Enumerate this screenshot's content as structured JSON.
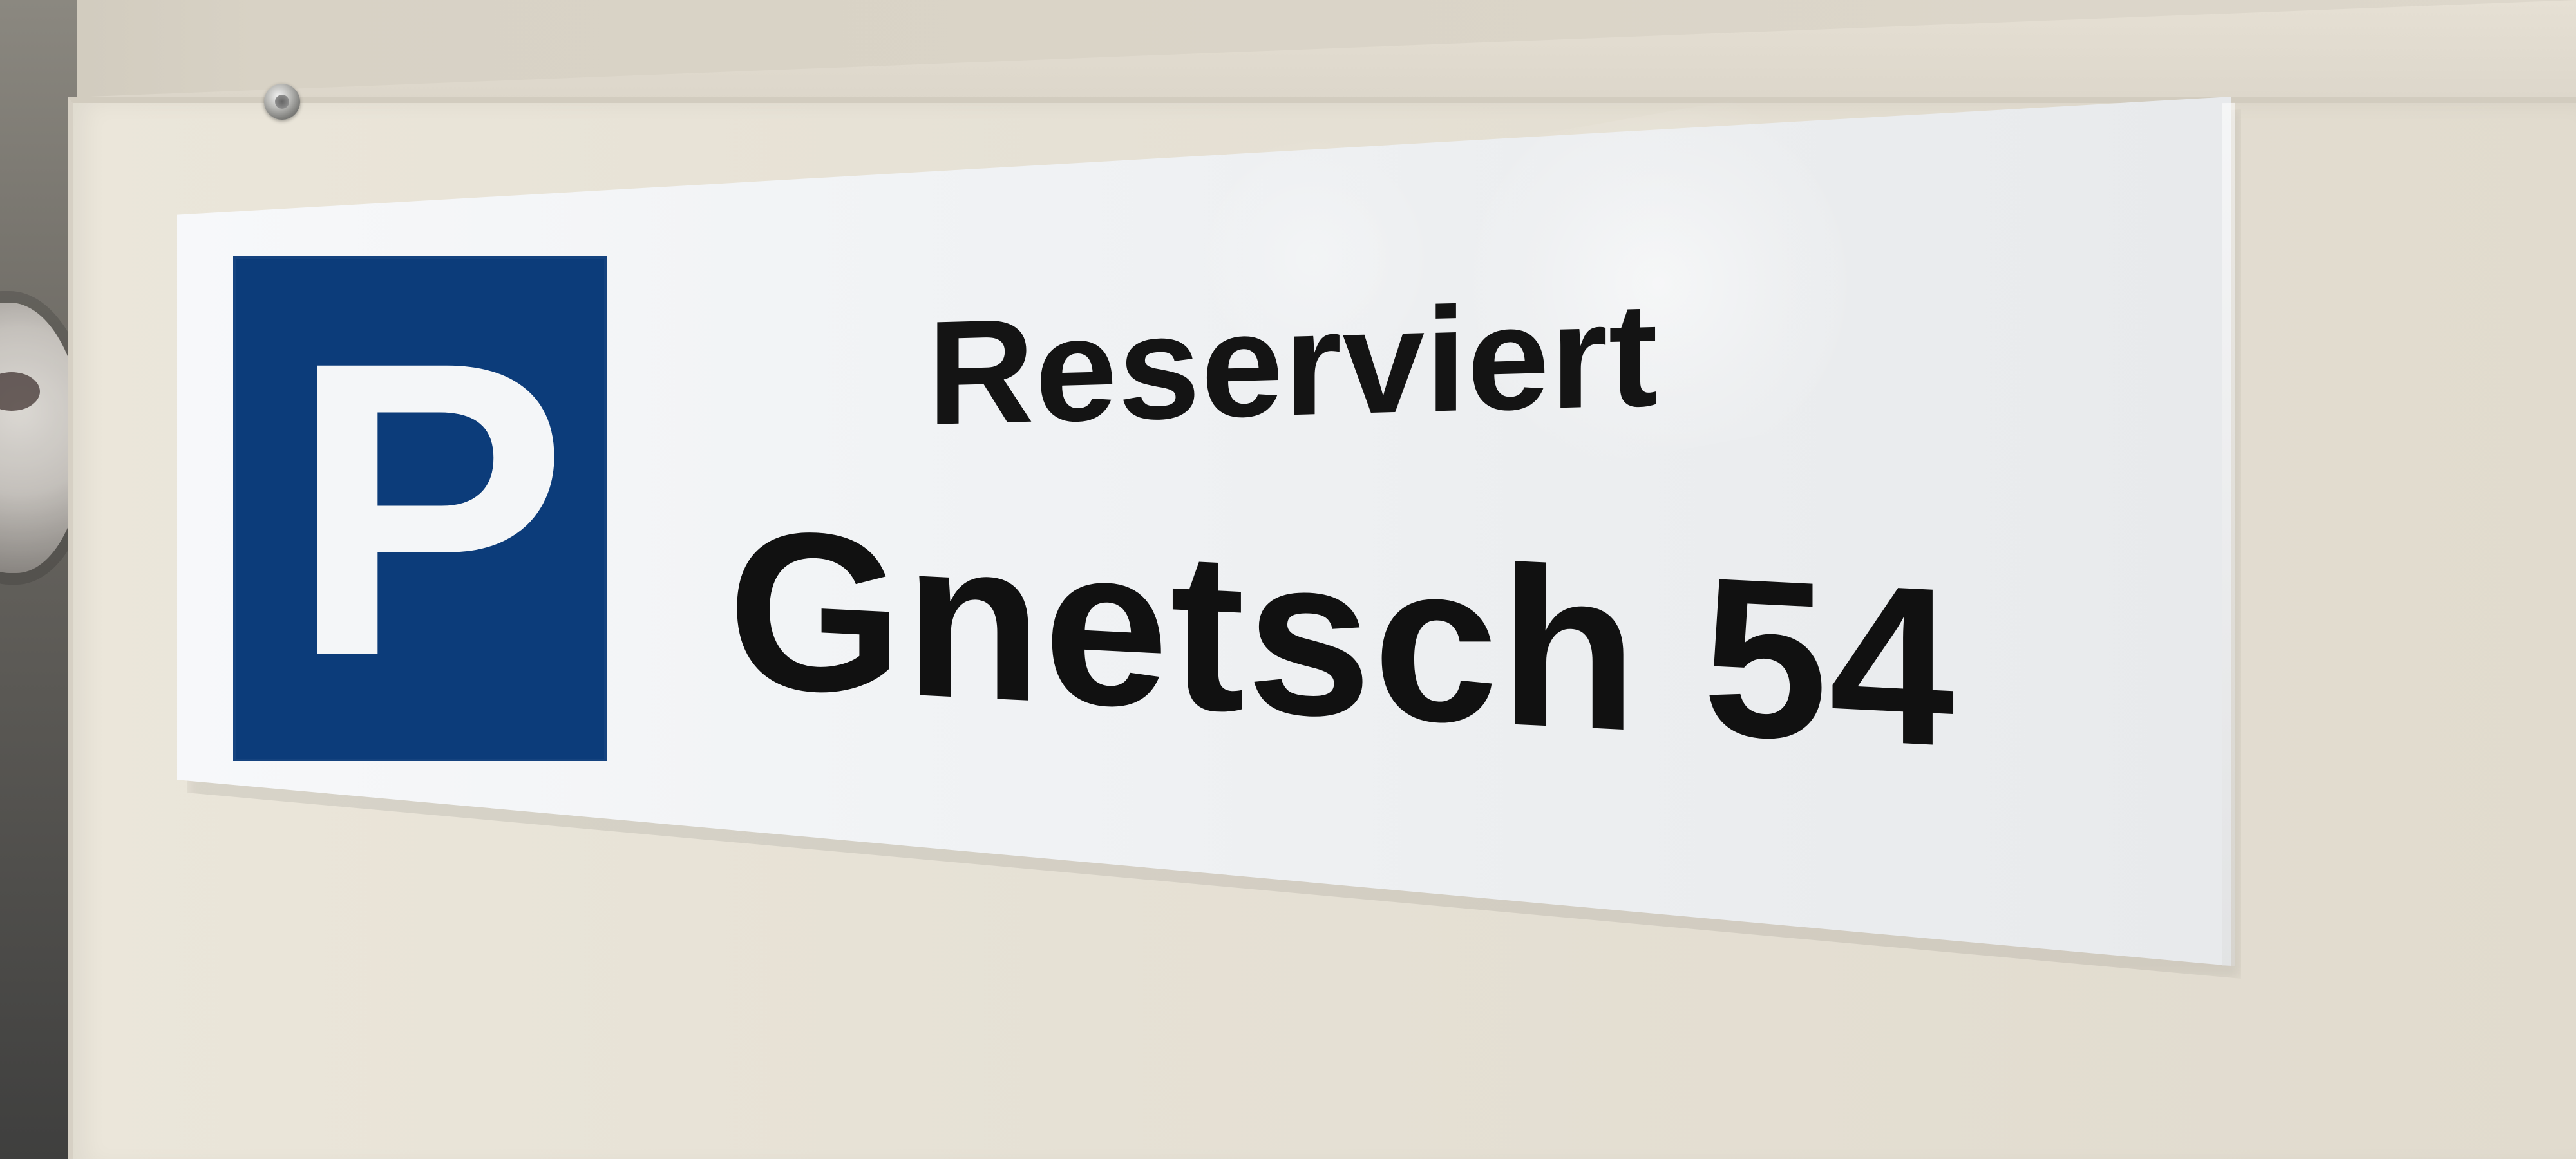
{
  "sign": {
    "icon_letter": "P",
    "title": "Reserviert",
    "name": "Gnetsch 54"
  },
  "icons": {
    "parking": "parking-icon"
  },
  "colors": {
    "sign_blue": "#0c3c7a",
    "sign_white": "#f3f4f6",
    "text_black": "#111111",
    "wall": "#e4dfd3"
  }
}
